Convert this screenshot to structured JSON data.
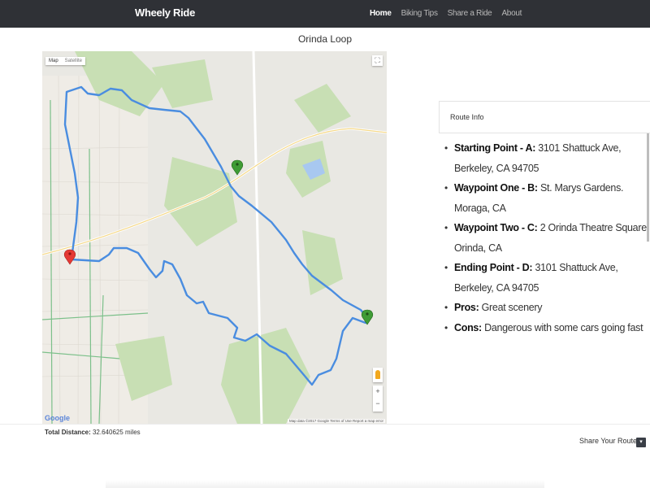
{
  "navbar": {
    "brand": "Wheely Ride",
    "links": [
      {
        "label": "Home",
        "active": true
      },
      {
        "label": "Biking Tips",
        "active": false
      },
      {
        "label": "Share a Ride",
        "active": false
      },
      {
        "label": "About",
        "active": false
      }
    ]
  },
  "page_title": "Orinda Loop",
  "map": {
    "type_toggle": {
      "map": "Map",
      "satellite": "Satellite"
    },
    "fullscreen_icon": "fullscreen-icon",
    "zoom_in": "+",
    "zoom_out": "−",
    "attribution": "Map data ©2017 Google   Terms of Use   Report a map error",
    "logo": "Google",
    "route_color": "#4a8de0",
    "markers": [
      {
        "label": "A",
        "color": "#e53935"
      },
      {
        "label": "B",
        "color": "#3f9c35"
      },
      {
        "label": "C",
        "color": "#3f9c35"
      }
    ]
  },
  "route_info": {
    "title": "Route Info",
    "items": [
      {
        "label": "Starting Point - A:",
        "text": " 3101 Shattuck Ave, Berkeley, CA 94705"
      },
      {
        "label": "Waypoint One - B:",
        "text": " St. Marys Gardens. Moraga, CA"
      },
      {
        "label": "Waypoint Two - C:",
        "text": " 2 Orinda Theatre Square. Orinda, CA"
      },
      {
        "label": "Ending Point - D:",
        "text": " 3101 Shattuck Ave, Berkeley, CA 94705"
      },
      {
        "label": "Pros:",
        "text": " Great scenery"
      },
      {
        "label": "Cons:",
        "text": " Dangerous with some cars going fast"
      }
    ]
  },
  "footer": {
    "distance_label": "Total Distance:",
    "distance_value": " 32.640625 miles",
    "share_label": "Share Your Route",
    "share_icon": "share-icon"
  }
}
